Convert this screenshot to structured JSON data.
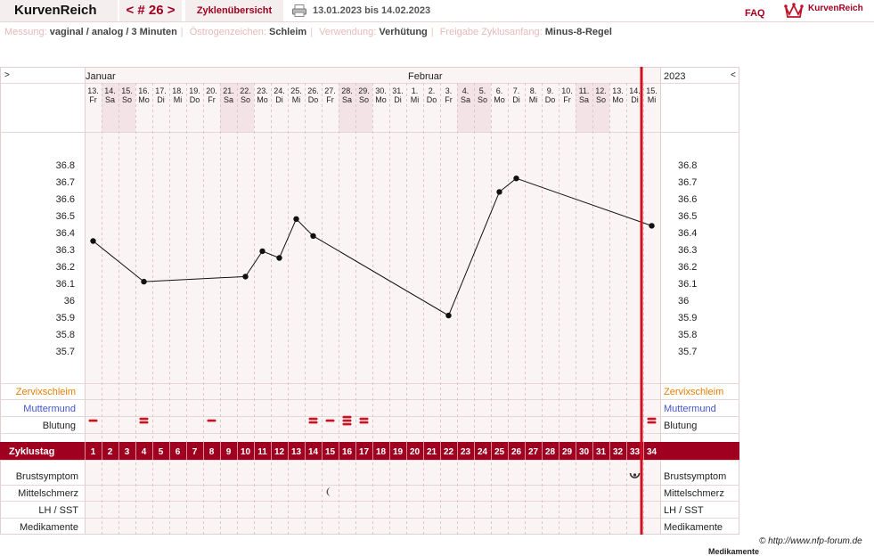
{
  "header": {
    "brand": "KurvenReich",
    "cycle_nav": "< # 26 >",
    "overview": "Zyklenübersicht",
    "date_range": "13.01.2023 bis 14.02.2023",
    "faq": "FAQ",
    "logo_text": "KurvenReich"
  },
  "meta": {
    "messung_label": "Messung:",
    "messung_value": "vaginal / analog / 3 Minuten",
    "oestrogen_label": "Östrogenzeichen:",
    "oestrogen_value": "Schleim",
    "verwendung_label": "Verwendung:",
    "verwendung_value": "Verhütung",
    "freigabe_label": "Freigabe Zyklusanfang:",
    "freigabe_value": "Minus-8-Regel"
  },
  "nav": {
    "left": ">",
    "right": "<"
  },
  "months": {
    "january": "Januar",
    "february": "Februar",
    "year": "2023"
  },
  "days": [
    {
      "d": "13.",
      "w": "Fr"
    },
    {
      "d": "14.",
      "w": "Sa"
    },
    {
      "d": "15.",
      "w": "So"
    },
    {
      "d": "16.",
      "w": "Mo"
    },
    {
      "d": "17.",
      "w": "Di"
    },
    {
      "d": "18.",
      "w": "Mi"
    },
    {
      "d": "19.",
      "w": "Do"
    },
    {
      "d": "20.",
      "w": "Fr"
    },
    {
      "d": "21.",
      "w": "Sa"
    },
    {
      "d": "22.",
      "w": "So"
    },
    {
      "d": "23.",
      "w": "Mo"
    },
    {
      "d": "24.",
      "w": "Di"
    },
    {
      "d": "25.",
      "w": "Mi"
    },
    {
      "d": "26.",
      "w": "Do"
    },
    {
      "d": "27.",
      "w": "Fr"
    },
    {
      "d": "28.",
      "w": "Sa"
    },
    {
      "d": "29.",
      "w": "So"
    },
    {
      "d": "30.",
      "w": "Mo"
    },
    {
      "d": "31.",
      "w": "Di"
    },
    {
      "d": "1.",
      "w": "Mi"
    },
    {
      "d": "2.",
      "w": "Do"
    },
    {
      "d": "3.",
      "w": "Fr"
    },
    {
      "d": "4.",
      "w": "Sa"
    },
    {
      "d": "5.",
      "w": "So"
    },
    {
      "d": "6.",
      "w": "Mo"
    },
    {
      "d": "7.",
      "w": "Di"
    },
    {
      "d": "8.",
      "w": "Mi"
    },
    {
      "d": "9.",
      "w": "Do"
    },
    {
      "d": "10.",
      "w": "Fr"
    },
    {
      "d": "11.",
      "w": "Sa"
    },
    {
      "d": "12.",
      "w": "So"
    },
    {
      "d": "13.",
      "w": "Mo"
    },
    {
      "d": "14.",
      "w": "Di"
    },
    {
      "d": "15.",
      "w": "Mi"
    }
  ],
  "weekend_colors": {
    "weekend": "#f3e3e6",
    "chart_bg": "#fbf4f4",
    "accent": "#a00020",
    "marker": "#d01020"
  },
  "rows": {
    "zervix": "Zervixschleim",
    "muttermund": "Muttermund",
    "blutung": "Blutung",
    "zyklustag": "Zyklustag",
    "brust": "Brustsymptom",
    "mittel": "Mittelschmerz",
    "lh": "LH / SST",
    "medi": "Medikamente"
  },
  "row_colors": {
    "zervix": "#e87d00",
    "muttermund": "#4455cc"
  },
  "bleeding": [
    {
      "day": 1,
      "marks": 1
    },
    {
      "day": 4,
      "marks": 2
    },
    {
      "day": 8,
      "marks": 1
    },
    {
      "day": 14,
      "marks": 2
    },
    {
      "day": 15,
      "marks": 1
    },
    {
      "day": 16,
      "marks": 3
    },
    {
      "day": 17,
      "marks": 2
    },
    {
      "day": 34,
      "marks": 2
    }
  ],
  "symbols": {
    "brust": {
      "day": 33,
      "icon": "breast-symptom-icon"
    },
    "mittel": {
      "day": 15,
      "icon": "crescent-pain-icon"
    }
  },
  "footer": {
    "credit": "© http://www.nfp-forum.de",
    "cut_text": "Medikamente"
  },
  "chart_data": {
    "type": "line",
    "ylim": [
      35.6,
      36.8
    ],
    "yticks": [
      36.8,
      36.7,
      36.6,
      36.5,
      36.4,
      36.3,
      36.2,
      36.1,
      36,
      35.9,
      35.8,
      35.7
    ],
    "series": [
      {
        "values": [
          {
            "day": 1,
            "temp": 36.35
          },
          {
            "day": 4,
            "temp": 36.11
          },
          {
            "day": 10,
            "temp": 36.14
          },
          {
            "day": 11,
            "temp": 36.29
          },
          {
            "day": 12,
            "temp": 36.25
          },
          {
            "day": 13,
            "temp": 36.48
          },
          {
            "day": 14,
            "temp": 36.38
          },
          {
            "day": 22,
            "temp": 35.91
          },
          {
            "day": 25,
            "temp": 36.64
          },
          {
            "day": 26,
            "temp": 36.72
          },
          {
            "day": 34,
            "temp": 36.44
          }
        ]
      }
    ]
  }
}
